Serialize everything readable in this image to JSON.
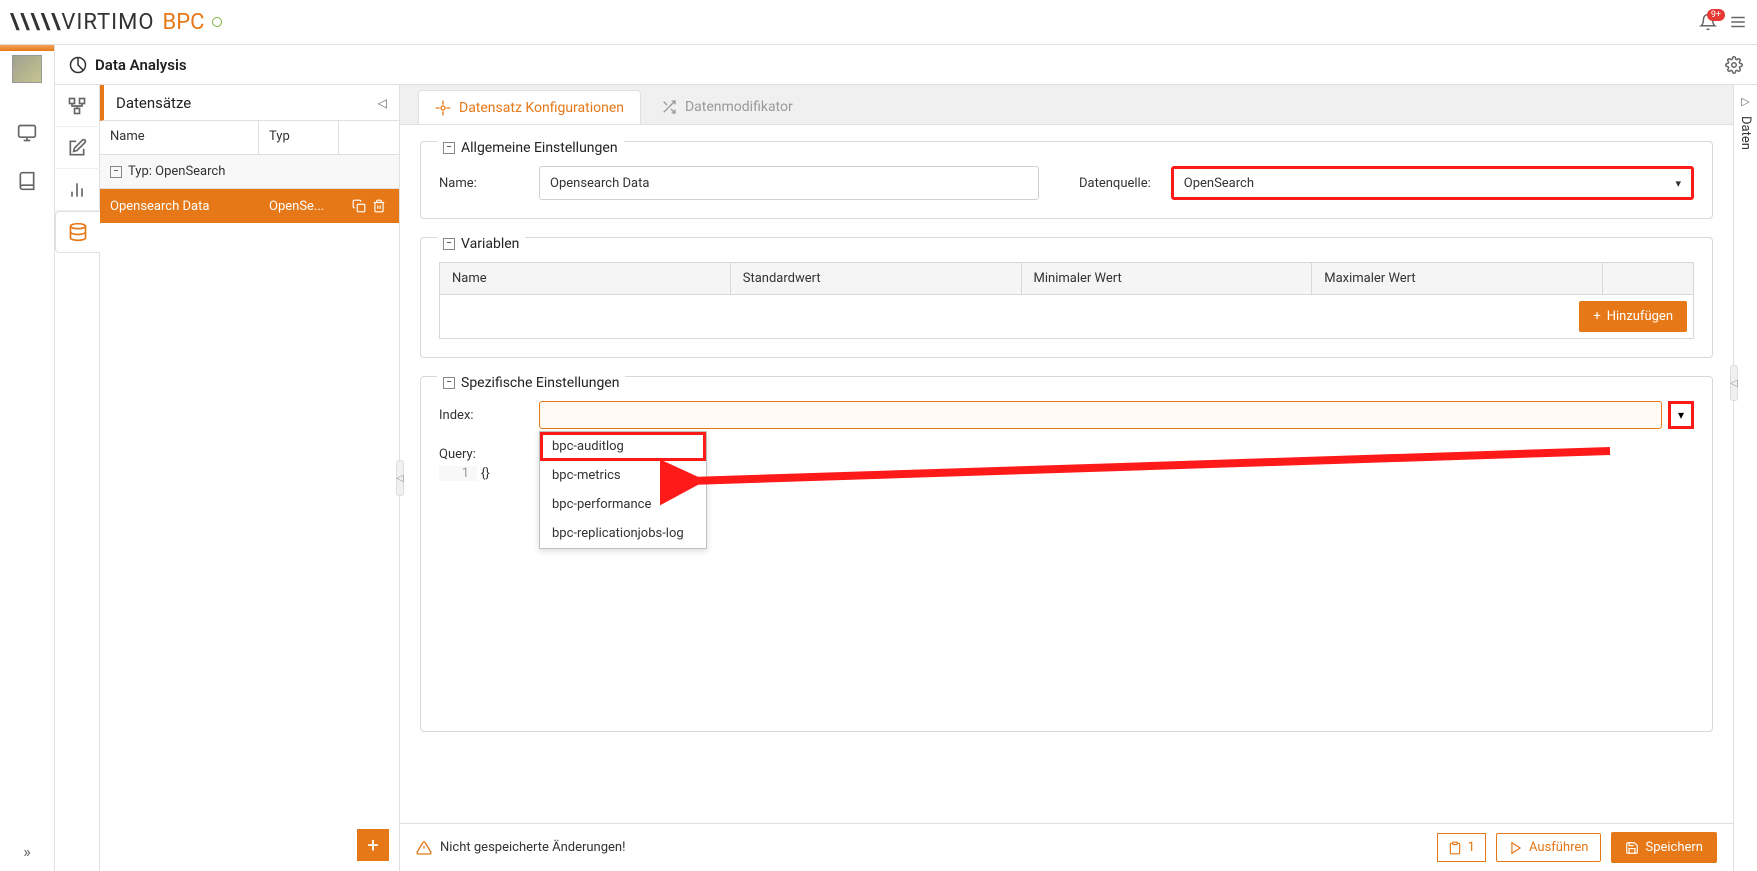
{
  "header": {
    "logo_virtimo": "VIRTIMO",
    "logo_bpc": "BPC",
    "notification_count": "9+"
  },
  "page": {
    "title": "Data Analysis"
  },
  "datasets_panel": {
    "title": "Datensätze",
    "col_name": "Name",
    "col_type": "Typ",
    "group_label": "Typ: OpenSearch",
    "row": {
      "name": "Opensearch Data",
      "type": "OpenSe..."
    }
  },
  "tabs": {
    "config": "Datensatz Konfigurationen",
    "modifier": "Datenmodifikator"
  },
  "general": {
    "legend": "Allgemeine Einstellungen",
    "name_label": "Name:",
    "name_value": "Opensearch Data",
    "source_label": "Datenquelle:",
    "source_value": "OpenSearch"
  },
  "variables": {
    "legend": "Variablen",
    "col_name": "Name",
    "col_default": "Standardwert",
    "col_min": "Minimaler Wert",
    "col_max": "Maximaler Wert",
    "add_label": "Hinzufügen"
  },
  "specific": {
    "legend": "Spezifische Einstellungen",
    "index_label": "Index:",
    "query_label": "Query:",
    "query_line": "1",
    "query_content": "{}",
    "options": [
      "bpc-auditlog",
      "bpc-metrics",
      "bpc-performance",
      "bpc-replicationjobs-log"
    ]
  },
  "footer": {
    "warning": "Nicht gespeicherte Änderungen!",
    "count": "1",
    "run": "Ausführen",
    "save": "Speichern"
  },
  "right_panel": {
    "label": "Daten"
  }
}
